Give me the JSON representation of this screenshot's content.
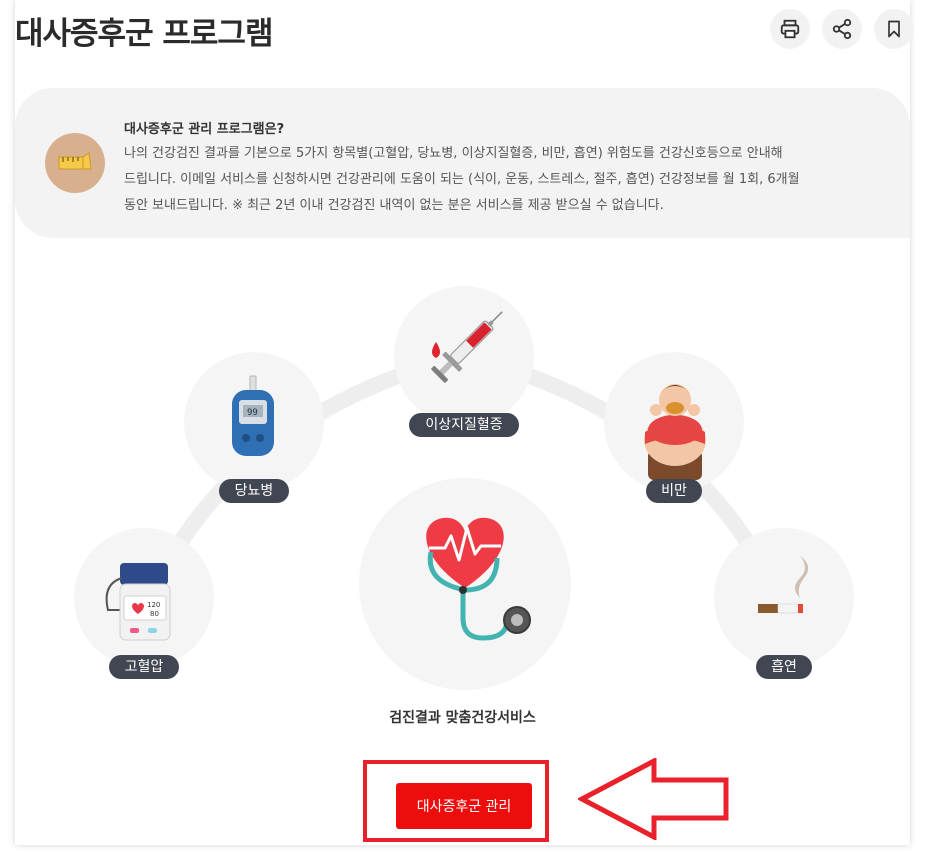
{
  "page": {
    "title": "대사증후군 프로그램"
  },
  "toolbar": {
    "print_icon": "print-icon",
    "share_icon": "share-icon",
    "bookmark_icon": "bookmark-icon"
  },
  "info": {
    "icon": "tape-measure-icon",
    "title": "대사증후군 관리 프로그램은?",
    "lines": [
      "나의 건강검진 결과를 기본으로 5가지 항목별(고혈압, 당뇨병, 이상지질혈증, 비만, 흡연) 위험도를 건강신호등으로 안내해",
      "드립니다. 이메일 서비스를 신청하시면 건강관리에 도움이 되는 (식이, 운동, 스트레스, 절주, 흡연) 건강정보를 월 1회, 6개월",
      "동안 보내드립니다. ※ 최근 2년 이내 건강검진 내역이 없는 분은 서비스를 제공 받으실 수 없습니다."
    ]
  },
  "items": [
    {
      "label": "고혈압",
      "icon": "blood-pressure-monitor-icon",
      "monitor_top": "120",
      "monitor_bottom": "80"
    },
    {
      "label": "당뇨병",
      "icon": "glucose-meter-icon",
      "meter_value": "99"
    },
    {
      "label": "이상지질혈증",
      "icon": "syringe-icon"
    },
    {
      "label": "비만",
      "icon": "obese-person-icon"
    },
    {
      "label": "흡연",
      "icon": "cigarette-icon"
    }
  ],
  "center": {
    "icon": "heart-stethoscope-icon",
    "label": "검진결과 맞춤건강서비스"
  },
  "cta": {
    "label": "대사증후군 관리"
  },
  "annotation": {
    "color": "#e8212b",
    "arrow_icon": "left-arrow-icon"
  },
  "colors": {
    "cta": "#ee0d0d",
    "pill": "#414652",
    "heart": "#ee3b45"
  }
}
